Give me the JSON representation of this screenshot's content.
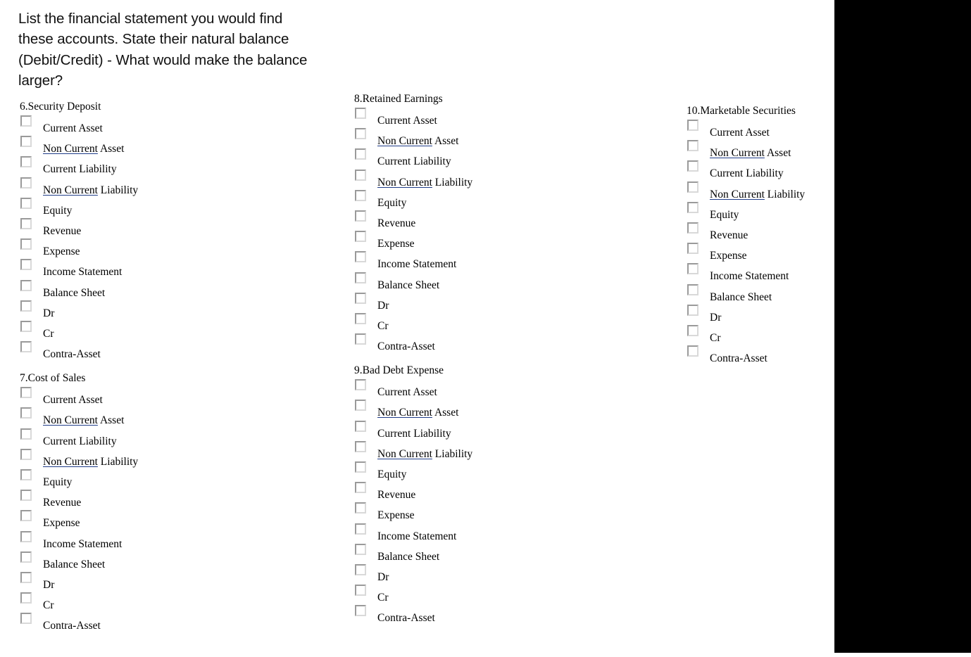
{
  "page": {
    "prompt": "List the financial statement you would find these accounts. State their natural balance (Debit/Credit) - What would make the balance larger?",
    "band_color": "#000000",
    "spellcheck_underline_color": "#1f3c88"
  },
  "option_set": [
    {
      "prefix": "",
      "marked": "",
      "suffix": "Current Asset"
    },
    {
      "prefix": "",
      "marked": "Non Current",
      "suffix": " Asset"
    },
    {
      "prefix": "",
      "marked": "",
      "suffix": "Current Liability"
    },
    {
      "prefix": "",
      "marked": "Non Current",
      "suffix": " Liability"
    },
    {
      "prefix": "",
      "marked": "",
      "suffix": "Equity"
    },
    {
      "prefix": "",
      "marked": "",
      "suffix": "Revenue"
    },
    {
      "prefix": "",
      "marked": "",
      "suffix": "Expense"
    },
    {
      "prefix": "",
      "marked": "",
      "suffix": "Income Statement"
    },
    {
      "prefix": "",
      "marked": "",
      "suffix": "Balance Sheet"
    },
    {
      "prefix": "",
      "marked": "",
      "suffix": "Dr"
    },
    {
      "prefix": "",
      "marked": "",
      "suffix": "Cr"
    },
    {
      "prefix": "",
      "marked": "",
      "suffix": "Contra-Asset"
    }
  ],
  "columns": [
    {
      "id": "column-1",
      "groups": [
        {
          "number": "6.",
          "title": "6.Security Deposit",
          "account": "Security Deposit"
        },
        {
          "number": "7.",
          "title": "7.Cost of Sales",
          "account": "Cost of Sales"
        }
      ]
    },
    {
      "id": "column-2",
      "groups": [
        {
          "number": "8.",
          "title": "8.Retained Earnings",
          "account": "Retained Earnings"
        },
        {
          "number": "9.",
          "title": "9.Bad Debt Expense",
          "account": "Bad Debt Expense"
        }
      ]
    },
    {
      "id": "column-3",
      "groups": [
        {
          "number": "10.",
          "title": "10.Marketable Securities",
          "account": "Marketable Securities"
        }
      ]
    }
  ]
}
